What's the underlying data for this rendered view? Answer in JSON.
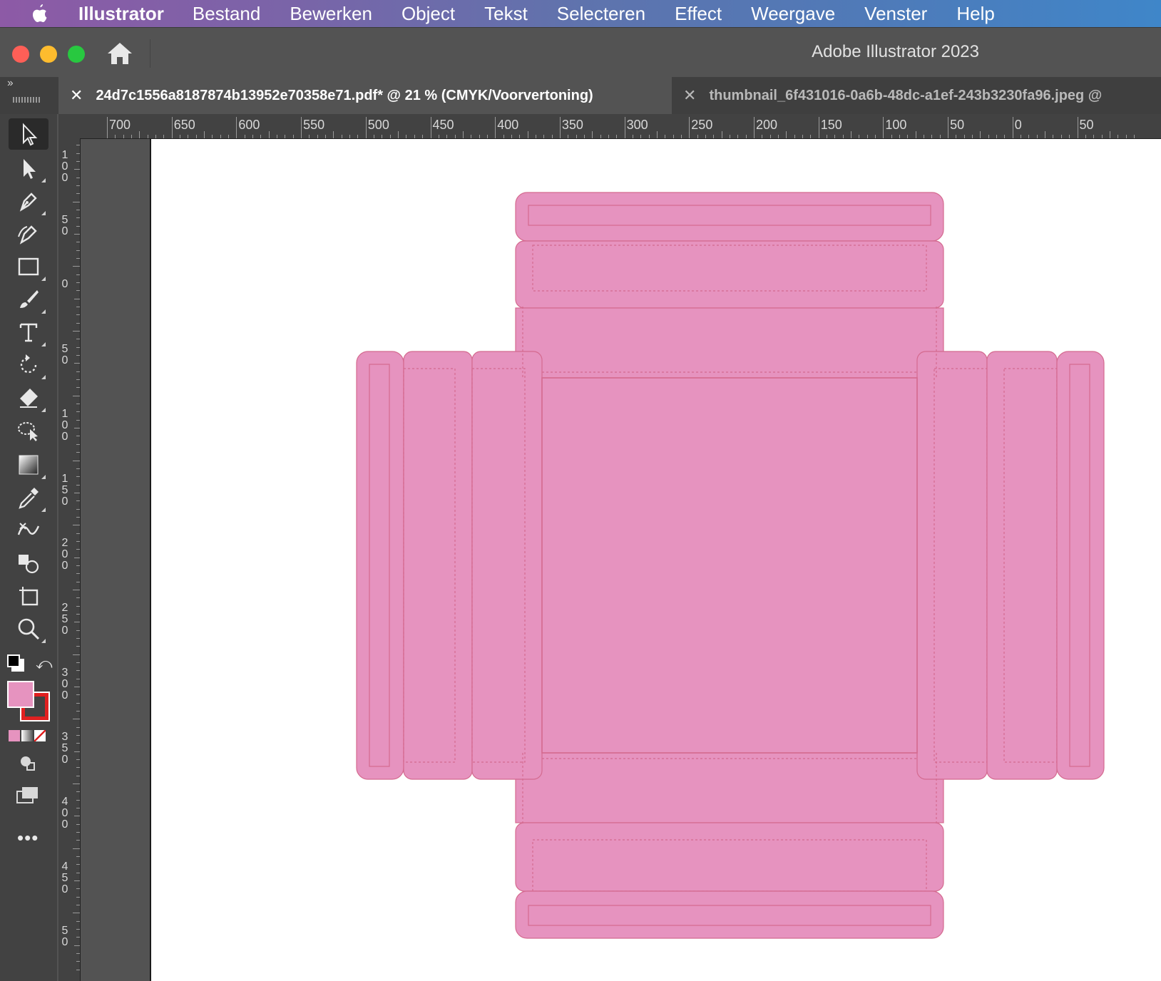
{
  "menubar": {
    "app_name": "Illustrator",
    "items": [
      "Bestand",
      "Bewerken",
      "Object",
      "Tekst",
      "Selecteren",
      "Effect",
      "Weergave",
      "Venster",
      "Help"
    ]
  },
  "window": {
    "title": "Adobe Illustrator 2023"
  },
  "tabs": [
    {
      "label": "24d7c1556a8187874b13952e70358e71.pdf* @ 21 % (CMYK/Voorvertoning)",
      "active": true
    },
    {
      "label": "thumbnail_6f431016-0a6b-48dc-a1ef-243b3230fa96.jpeg @",
      "active": false
    }
  ],
  "tools": [
    "selection-tool",
    "direct-selection-tool",
    "pen-tool",
    "curvature-tool",
    "rectangle-tool",
    "paintbrush-tool",
    "type-tool",
    "rotate-tool",
    "eraser-tool",
    "lasso-tool",
    "gradient-tool",
    "eyedropper-tool",
    "puppet-warp-tool",
    "shape-builder-tool",
    "artboard-tool",
    "zoom-tool"
  ],
  "colors": {
    "fill": "#e693bf",
    "stroke": "#e02020",
    "fold_line": "#d46a8f",
    "artboard": "#ffffff",
    "menubar_accent": "#7a64a8"
  },
  "rulers": {
    "horizontal_labels": [
      "700",
      "650",
      "600",
      "550",
      "500",
      "450",
      "400",
      "350",
      "300",
      "250",
      "200",
      "150",
      "100",
      "50",
      "0",
      "50"
    ],
    "vertical_labels": [
      "100",
      "50",
      "0",
      "50",
      "100",
      "150",
      "200",
      "250",
      "300",
      "350",
      "400",
      "450",
      "50"
    ]
  }
}
